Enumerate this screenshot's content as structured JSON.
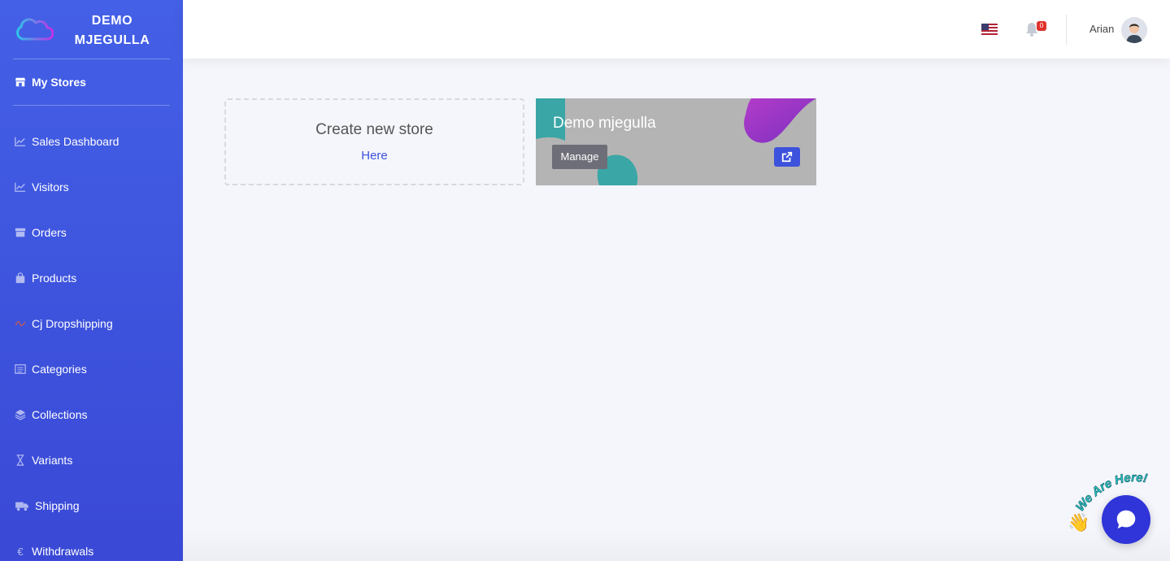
{
  "brand": {
    "line1": "DEMO",
    "line2": "MJEGULLA"
  },
  "sidebar": {
    "items": [
      {
        "label": "My Stores",
        "icon": "store-icon",
        "active": true
      },
      {
        "label": "Sales Dashboard",
        "icon": "chart-line-icon"
      },
      {
        "label": "Visitors",
        "icon": "chart-line-icon"
      },
      {
        "label": "Orders",
        "icon": "box-icon"
      },
      {
        "label": "Products",
        "icon": "bag-icon"
      },
      {
        "label": "Cj Dropshipping",
        "icon": "cj-logo-icon"
      },
      {
        "label": "Categories",
        "icon": "list-icon"
      },
      {
        "label": "Collections",
        "icon": "layers-icon"
      },
      {
        "label": "Variants",
        "icon": "hourglass-icon"
      },
      {
        "label": "Shipping",
        "icon": "truck-icon"
      },
      {
        "label": "Withdrawals",
        "icon": "euro-icon"
      }
    ]
  },
  "header": {
    "notifications_count": "0",
    "user_name": "Arian"
  },
  "create_card": {
    "title": "Create new store",
    "link": "Here"
  },
  "store_card": {
    "title": "Demo mjegulla",
    "manage_label": "Manage"
  },
  "chat": {
    "tagline": "We Are Here!"
  },
  "colors": {
    "primary": "#3d52dc",
    "sidebar": "#4460e6",
    "badge": "#e0322c"
  }
}
